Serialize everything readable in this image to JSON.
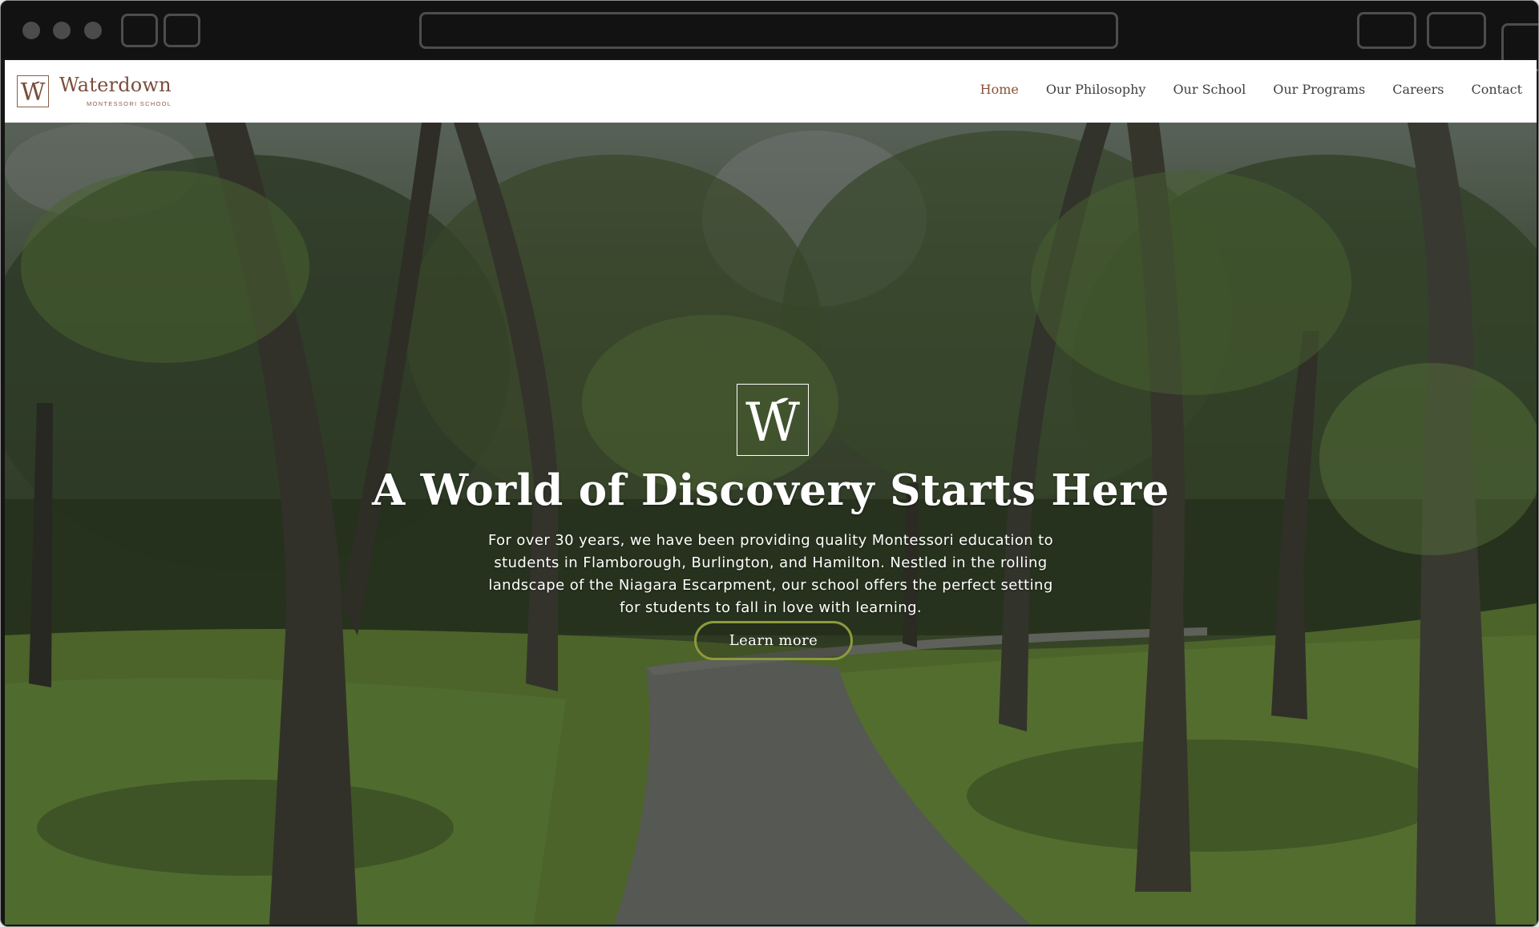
{
  "brand": {
    "name": "Waterdown",
    "subtitle": "MONTESSORI SCHOOL",
    "mark_letter": "W",
    "color": "#7a4d3b"
  },
  "nav": {
    "items": [
      {
        "label": "Home",
        "active": true
      },
      {
        "label": "Our Philosophy",
        "active": false
      },
      {
        "label": "Our School",
        "active": false
      },
      {
        "label": "Our Programs",
        "active": false
      },
      {
        "label": "Careers",
        "active": false
      },
      {
        "label": "Contact",
        "active": false
      }
    ],
    "active_color": "#8b4f36"
  },
  "hero": {
    "mark_letter": "W",
    "title": "A World of Discovery Starts Here",
    "text": "For over 30 years, we have been providing quality Montessori education to students in Flamborough, Burlington, and Hamilton.  Nestled in the rolling landscape of the Niagara Escarpment, our school offers the perfect setting for students to fall in love with learning.",
    "cta_label": "Learn more",
    "cta_border_color": "#8c9a3b",
    "background": "photo of tree-lined park path"
  },
  "icons": {
    "logo": "w-leaf-monogram-icon"
  }
}
